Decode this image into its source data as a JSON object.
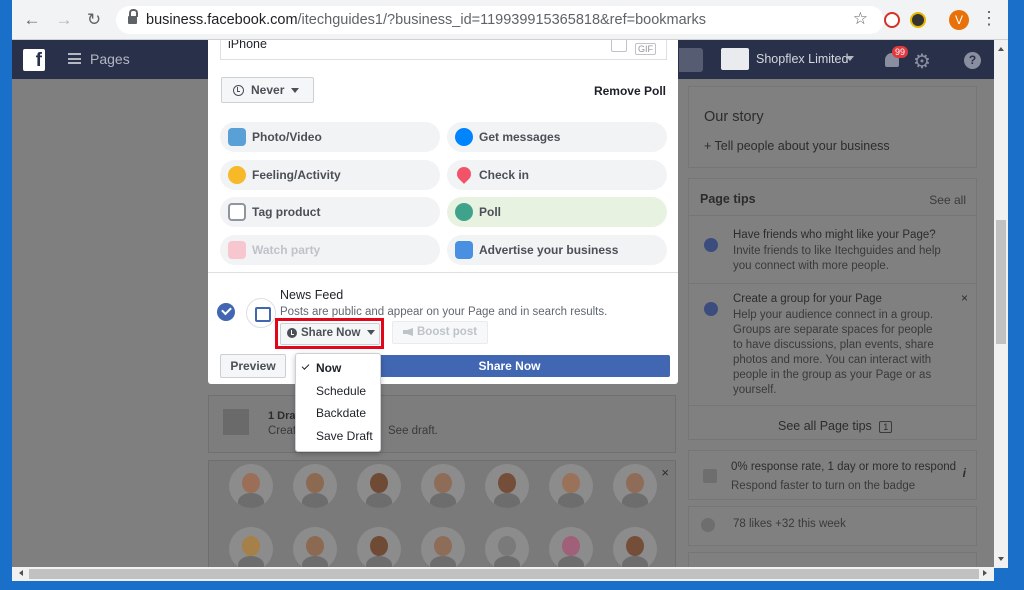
{
  "browser": {
    "url_host": "business.facebook.com",
    "url_path": "/itechguides1/?business_id=119939915365818&ref=bookmarks",
    "profile_initial": "V"
  },
  "fb_header": {
    "pages_label": "Pages",
    "business_name": "Shopflex Limited",
    "notification_count": "99"
  },
  "composer": {
    "input_text": "iPhone",
    "gif_label": "GIF",
    "duration_label": "Never",
    "remove_poll_label": "Remove Poll",
    "options": [
      {
        "label": "Photo/Video",
        "icon": "photo-icon"
      },
      {
        "label": "Get messages",
        "icon": "messenger-icon"
      },
      {
        "label": "Feeling/Activity",
        "icon": "smiley-icon"
      },
      {
        "label": "Check in",
        "icon": "map-pin-icon"
      },
      {
        "label": "Tag product",
        "icon": "tag-icon"
      },
      {
        "label": "Poll",
        "icon": "poll-icon"
      },
      {
        "label": "Watch party",
        "icon": "popcorn-icon"
      },
      {
        "label": "Advertise your business",
        "icon": "advertise-icon"
      }
    ],
    "news_feed_title": "News Feed",
    "news_feed_desc": "Posts are public and appear on your Page and in search results.",
    "share_now_dropdown": "Share Now",
    "boost_post_label": "Boost post",
    "preview_label": "Preview",
    "share_now_button": "Share Now"
  },
  "share_menu": {
    "items": [
      "Now",
      "Schedule",
      "Backdate",
      "Save Draft"
    ],
    "selected": "Now"
  },
  "drafts": {
    "count_label": "1 Draf",
    "text_partial": "Creat",
    "see_draft": "See draft."
  },
  "sidebar": {
    "our_story_title": "Our story",
    "our_story_link": "+ Tell people about your business",
    "page_tips_title": "Page tips",
    "see_all": "See all",
    "tip1_title": "Have friends who might like your Page?",
    "tip1_body": "Invite friends to like Itechguides and help you connect with more people.",
    "tip2_title": "Create a group for your Page",
    "tip2_body": "Help your audience connect in a group. Groups are separate spaces for people to have discussions, plan events, share photos and more. You can interact with people in the group as your Page or as yourself.",
    "see_all_tips": "See all Page tips",
    "tips_count": "1",
    "response_title": "0% response rate, 1 day or more to respond",
    "response_sub": "Respond faster to turn on the badge",
    "likes_text": "78 likes +32 this week"
  },
  "colors": {
    "facebook_blue": "#4267b2",
    "highlight_red": "#e3051a",
    "header_navy": "#29304a",
    "poll_selected": "#e7f3e0"
  }
}
